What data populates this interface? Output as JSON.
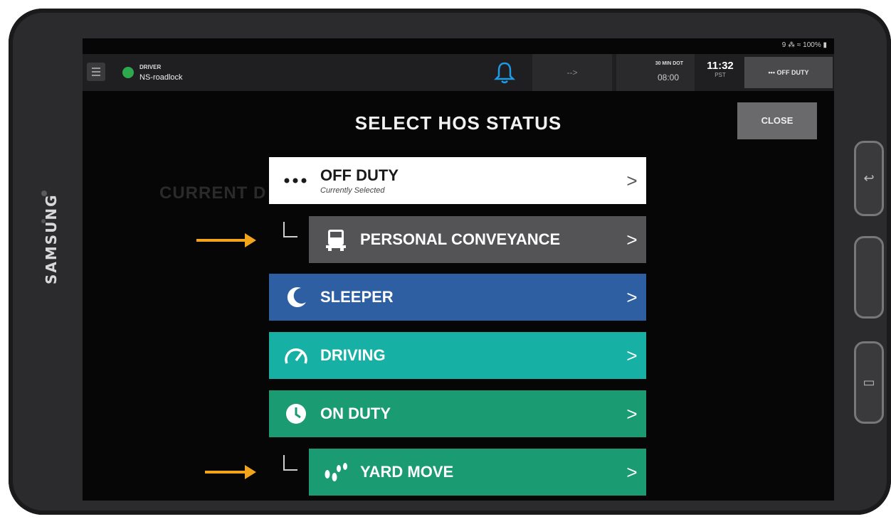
{
  "device": {
    "brand": "SAMSUNG"
  },
  "status_bar": {
    "text": "9 ⁂ ≈ 100% ▮"
  },
  "app_bar": {
    "driver_label": "DRIVER",
    "driver_name": "NS-roadlock",
    "bell_icon": "bell-icon",
    "middle_value": "-->",
    "dot_label": "30 MIN DOT",
    "dot_value": "08:00",
    "time": "11:32",
    "timezone": "PST",
    "current_status": "••• OFF DUTY"
  },
  "modal": {
    "title": "SELECT HOS STATUS",
    "close_label": "CLOSE",
    "background_text": "CURRENT D",
    "options": [
      {
        "label": "OFF DUTY",
        "sublabel": "Currently Selected",
        "icon": "dots-icon",
        "color": "#ffffff"
      },
      {
        "label": "PERSONAL CONVEYANCE",
        "icon": "truck-icon",
        "color": "#545456"
      },
      {
        "label": "SLEEPER",
        "icon": "moon-icon",
        "color": "#2f5fa3"
      },
      {
        "label": "DRIVING",
        "icon": "speedometer-icon",
        "color": "#17b0a4"
      },
      {
        "label": "ON DUTY",
        "icon": "clock-icon",
        "color": "#1a9b71"
      },
      {
        "label": "YARD MOVE",
        "icon": "footsteps-icon",
        "color": "#1a9b71"
      }
    ],
    "chevron": ">"
  },
  "annotation_color": "#f2a51a"
}
